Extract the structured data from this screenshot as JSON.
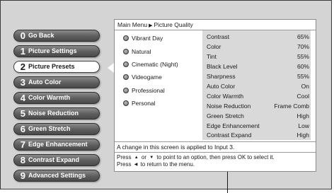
{
  "menu": {
    "items": [
      {
        "number": "0",
        "label": "Go Back",
        "selected": false
      },
      {
        "number": "1",
        "label": "Picture Settings",
        "selected": false
      },
      {
        "number": "2",
        "label": "Picture Presets",
        "selected": true
      },
      {
        "number": "3",
        "label": "Auto Color",
        "selected": false
      },
      {
        "number": "4",
        "label": "Color Warmth",
        "selected": false
      },
      {
        "number": "5",
        "label": "Noise Reduction",
        "selected": false
      },
      {
        "number": "6",
        "label": "Green Stretch",
        "selected": false
      },
      {
        "number": "7",
        "label": "Edge Enhancement",
        "selected": false
      },
      {
        "number": "8",
        "label": "Contrast Expand",
        "selected": false
      },
      {
        "number": "9",
        "label": "Advanced Settings",
        "selected": false
      }
    ]
  },
  "breadcrumb": {
    "root": "Main Menu",
    "separator": "▶",
    "current": "Picture Quality"
  },
  "presets": [
    {
      "label": "Vibrant Day"
    },
    {
      "label": "Natural"
    },
    {
      "label": "Cinematic (Night)"
    },
    {
      "label": "Videogame"
    },
    {
      "label": "Professional"
    },
    {
      "label": "Personal"
    }
  ],
  "settings": [
    {
      "label": "Contrast",
      "value": "65%"
    },
    {
      "label": "Color",
      "value": "70%"
    },
    {
      "label": "Tint",
      "value": "55%"
    },
    {
      "label": "Black Level",
      "value": "60%"
    },
    {
      "label": "Sharpness",
      "value": "55%"
    },
    {
      "label": "Auto Color",
      "value": "On"
    },
    {
      "label": "Color Warmth",
      "value": "Cool"
    },
    {
      "label": "Noise Reduction",
      "value": "Frame Comb"
    },
    {
      "label": "Green Stretch",
      "value": "High"
    },
    {
      "label": "Edge Enhancement",
      "value": "Low"
    },
    {
      "label": "Contrast Expand",
      "value": "High"
    }
  ],
  "info": "A change in this screen is applied to Input 3.",
  "help": {
    "line1_prefix": "Press",
    "up_arrow": "▲",
    "or": "or",
    "down_arrow": "▼",
    "line1_suffix": "to point to an option, then press OK to select it.",
    "line2_prefix": "Press",
    "left_arrow": "◀",
    "line2_suffix": "to return to the menu."
  },
  "colors": {
    "frame_bg": "#d4d4d4",
    "button_dark": "#5e5e5e",
    "button_selected": "#ffffff",
    "settings_bg": "#d9d9d9"
  }
}
